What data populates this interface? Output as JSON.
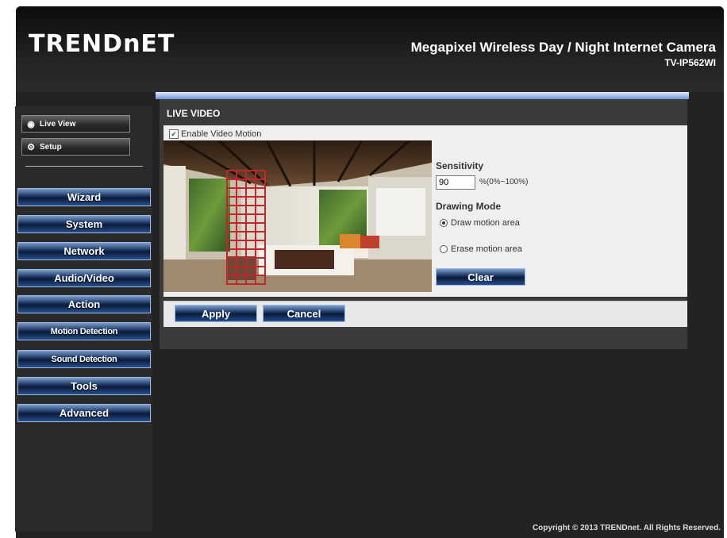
{
  "header": {
    "logo": "TRENDnET",
    "product": "Megapixel Wireless Day / Night Internet Camera",
    "model": "TV-IP562WI"
  },
  "sidebar": {
    "live_view": "Live View",
    "setup": "Setup",
    "menu": [
      "Wizard",
      "System",
      "Network",
      "Audio/Video",
      "Action",
      "Motion Detection",
      "Sound Detection",
      "Tools",
      "Advanced"
    ]
  },
  "panel": {
    "title": "LIVE VIDEO",
    "enable_label": "Enable Video Motion",
    "enable_checked": true,
    "sensitivity_label": "Sensitivity",
    "sensitivity_value": "90",
    "sensitivity_range": "%(0%~100%)",
    "drawing_mode_label": "Drawing Mode",
    "draw_label": "Draw motion area",
    "erase_label": "Erase motion area",
    "selected_mode": "draw",
    "clear_label": "Clear"
  },
  "actions": {
    "apply": "Apply",
    "cancel": "Cancel"
  },
  "footer": {
    "copyright": "Copyright © 2013 TRENDnet. All Rights Reserved."
  },
  "colors": {
    "frame": "#232323",
    "button_blue": "#172e58",
    "grid_red": "#c0272d"
  }
}
